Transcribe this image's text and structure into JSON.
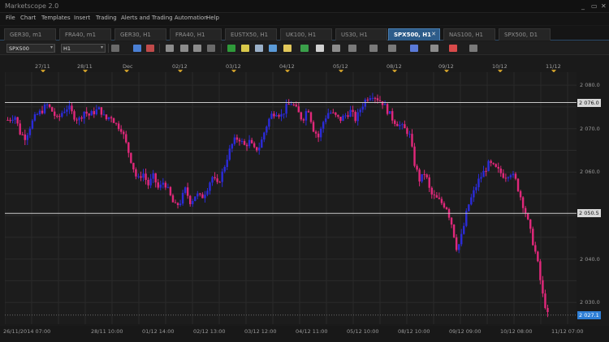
{
  "app": {
    "title": "Marketscope 2.0"
  },
  "window_controls": [
    {
      "name": "minimize-button",
      "glyph": "_"
    },
    {
      "name": "restore-button",
      "glyph": "▭"
    },
    {
      "name": "close-button",
      "glyph": "✕"
    }
  ],
  "menu": [
    "File",
    "Chart",
    "Templates",
    "Insert",
    "Trading",
    "Alerts and Trading Automation",
    "Help"
  ],
  "tabs": [
    {
      "label": "GER30, m1",
      "active": false
    },
    {
      "label": "FRA40, m1",
      "active": false
    },
    {
      "label": "GER30, H1",
      "active": false
    },
    {
      "label": "FRA40, H1",
      "active": false
    },
    {
      "label": "EUSTX50, H1",
      "active": false
    },
    {
      "label": "UK100, H1",
      "active": false
    },
    {
      "label": "US30, H1",
      "active": false
    },
    {
      "label": "SPX500, H1",
      "active": true,
      "close": "✕"
    },
    {
      "label": "NAS100, H1",
      "active": false
    },
    {
      "label": "SPX500, D1",
      "active": false
    }
  ],
  "toolbar": {
    "instrument": "SPX500",
    "timeframe": "H1",
    "dropdown_arrow": "▾",
    "icons": [
      "chart-type-icon",
      "bar-chart-icon",
      "candle-chart-icon",
      "crosshair-icon",
      "pointer-icon",
      "zoom-icon",
      "indicator-icon",
      "note-icon",
      "eraser-icon",
      "marker-icon",
      "pencil-icon",
      "trend-icon",
      "objects-icon",
      "color-icon",
      "settings-icon",
      "grid-icon",
      "fibonacci-icon",
      "line-tool-icon",
      "channel-icon",
      "magnet-icon",
      "brush-icon",
      "properties-icon"
    ]
  },
  "date_bar": {
    "labels": [
      "27/11",
      "28/11",
      "Dec",
      "02/12",
      "03/12",
      "04/12",
      "05/12",
      "08/12",
      "09/12",
      "10/12",
      "11/12"
    ]
  },
  "price_axis": {
    "ticks": [
      "2 080.0",
      "2 070.0",
      "2 060.0",
      "2 040.0",
      "2 030.0"
    ],
    "levels": [
      {
        "label": "2 076.0",
        "type": "line"
      },
      {
        "label": "2 050.5",
        "type": "line"
      },
      {
        "label": "2 027.1",
        "type": "current"
      }
    ]
  },
  "time_axis": [
    "26/11/2014 07:00",
    "28/11 10:00",
    "01/12 14:00",
    "02/12 13:00",
    "03/12 12:00",
    "04/12 11:00",
    "05/12 10:00",
    "08/12 10:00",
    "09/12 09:00",
    "10/12 08:00",
    "11/12 07:00"
  ],
  "colors": {
    "bull": "#2b2bd8",
    "bear": "#e0287a",
    "hline": "#c8c8c8",
    "current_price_bg": "#2f7fd6",
    "active_tab": "#2d5c8a",
    "marker": "#c79a2a"
  },
  "chart_data": {
    "type": "candlestick",
    "instrument": "SPX500",
    "timeframe": "H1",
    "ylim": [
      2025,
      2083
    ],
    "grid": true,
    "horizontal_lines": [
      2076.0,
      2050.5
    ],
    "current_price": 2027.1,
    "close_path": [
      [
        0,
        2072
      ],
      [
        4,
        2073
      ],
      [
        7,
        2069
      ],
      [
        10,
        2068
      ],
      [
        13,
        2071
      ],
      [
        16,
        2073
      ],
      [
        19,
        2074
      ],
      [
        22,
        2075.5
      ],
      [
        25,
        2074
      ],
      [
        28,
        2072
      ],
      [
        31,
        2074
      ],
      [
        34,
        2075
      ],
      [
        37,
        2073
      ],
      [
        40,
        2072
      ],
      [
        43,
        2074
      ],
      [
        46,
        2073
      ],
      [
        49,
        2074
      ],
      [
        52,
        2074.5
      ],
      [
        55,
        2072
      ],
      [
        58,
        2073
      ],
      [
        61,
        2071
      ],
      [
        64,
        2070
      ],
      [
        67,
        2066
      ],
      [
        70,
        2062
      ],
      [
        73,
        2058
      ],
      [
        76,
        2060
      ],
      [
        79,
        2057
      ],
      [
        82,
        2059
      ],
      [
        85,
        2056
      ],
      [
        88,
        2058
      ],
      [
        91,
        2055
      ],
      [
        94,
        2052
      ],
      [
        97,
        2053
      ],
      [
        100,
        2056
      ],
      [
        103,
        2053
      ],
      [
        106,
        2055
      ],
      [
        109,
        2054
      ],
      [
        112,
        2056
      ],
      [
        115,
        2059
      ],
      [
        118,
        2057
      ],
      [
        121,
        2060
      ],
      [
        124,
        2064
      ],
      [
        127,
        2067
      ],
      [
        130,
        2068
      ],
      [
        133,
        2066
      ],
      [
        136,
        2067
      ],
      [
        139,
        2065
      ],
      [
        142,
        2066
      ],
      [
        145,
        2070
      ],
      [
        148,
        2073
      ],
      [
        151,
        2074
      ],
      [
        154,
        2073
      ],
      [
        157,
        2075
      ],
      [
        160,
        2076
      ],
      [
        163,
        2074
      ],
      [
        166,
        2072
      ],
      [
        169,
        2075
      ],
      [
        172,
        2070
      ],
      [
        175,
        2068
      ],
      [
        178,
        2072
      ],
      [
        181,
        2074
      ],
      [
        184,
        2073
      ],
      [
        187,
        2072
      ],
      [
        190,
        2073
      ],
      [
        193,
        2074
      ],
      [
        196,
        2072
      ],
      [
        199,
        2075
      ],
      [
        202,
        2077
      ],
      [
        205,
        2078
      ],
      [
        208,
        2077
      ],
      [
        211,
        2076
      ],
      [
        214,
        2074
      ],
      [
        217,
        2072
      ],
      [
        220,
        2071
      ],
      [
        223,
        2070
      ],
      [
        226,
        2069
      ],
      [
        229,
        2062
      ],
      [
        232,
        2058
      ],
      [
        235,
        2060
      ],
      [
        238,
        2055
      ],
      [
        241,
        2054
      ],
      [
        244,
        2053
      ],
      [
        247,
        2052
      ],
      [
        250,
        2048
      ],
      [
        253,
        2042
      ],
      [
        256,
        2046
      ],
      [
        259,
        2052
      ],
      [
        262,
        2055
      ],
      [
        265,
        2058
      ],
      [
        268,
        2060
      ],
      [
        271,
        2062
      ],
      [
        274,
        2061
      ],
      [
        277,
        2060
      ],
      [
        280,
        2059
      ],
      [
        283,
        2060
      ],
      [
        286,
        2058
      ],
      [
        289,
        2054
      ],
      [
        292,
        2050
      ],
      [
        295,
        2045
      ],
      [
        298,
        2040
      ],
      [
        301,
        2032
      ],
      [
        304,
        2027.1
      ]
    ]
  }
}
